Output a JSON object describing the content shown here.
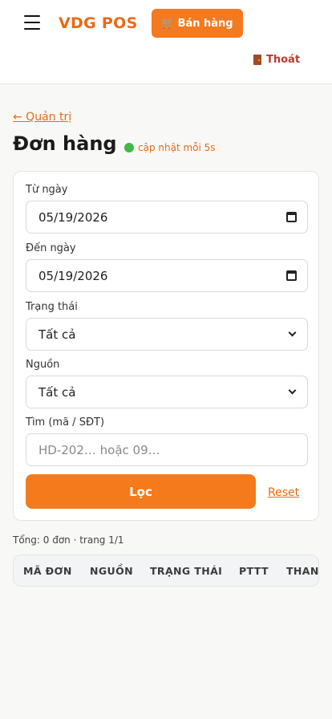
{
  "header": {
    "brand": "VDG POS",
    "sell_button": "Bán hàng",
    "sell_icon": "cart-icon",
    "logout": "Thoát",
    "logout_icon": "door-icon"
  },
  "nav": {
    "back_link": "← Quản trị"
  },
  "page": {
    "title": "Đơn hàng",
    "live_status": "cập nhật mỗi 5s"
  },
  "filters": {
    "from_label": "Từ ngày",
    "from_value": "05/19/2026",
    "to_label": "Đến ngày",
    "to_value": "05/19/2026",
    "status_label": "Trạng thái",
    "status_value": "Tất cả",
    "source_label": "Nguồn",
    "source_value": "Tất cả",
    "search_label": "Tìm (mã / SĐT)",
    "search_placeholder": "HD-202… hoặc 09…",
    "filter_button": "Lọc",
    "reset_link": "Reset"
  },
  "results": {
    "summary": "Tổng: 0 đơn · trang 1/1",
    "columns": [
      "MÃ ĐƠN",
      "NGUỒN",
      "TRẠNG THÁI",
      "PTTT",
      "THANH TOÁN"
    ]
  },
  "colors": {
    "accent": "#f47a20",
    "brand": "#ea6a17",
    "logout": "#c0392b",
    "live_dot": "#3fb948"
  }
}
